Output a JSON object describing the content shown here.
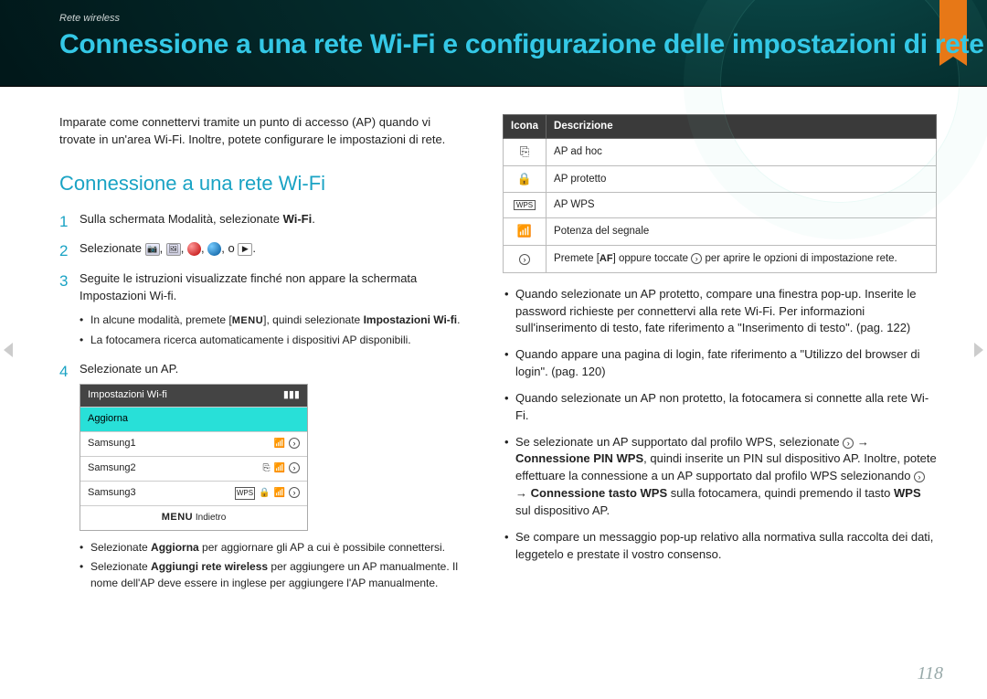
{
  "breadcrumb": "Rete wireless",
  "title": "Connessione a una rete Wi-Fi e configurazione delle impostazioni di rete",
  "intro": "Imparate come connettervi tramite un punto di accesso (AP) quando vi trovate in un'area Wi-Fi. Inoltre, potete configurare le impostazioni di rete.",
  "section_heading": "Connessione a una rete Wi-Fi",
  "steps": {
    "s1": {
      "num": "1",
      "text_a": "Sulla schermata Modalità, selezionate ",
      "bold": "Wi-Fi",
      "text_b": "."
    },
    "s2": {
      "num": "2",
      "text_a": "Selezionate ",
      "tail": ", o "
    },
    "s3": {
      "num": "3",
      "text": "Seguite le istruzioni visualizzate finché non appare la schermata Impostazioni Wi-fi.",
      "sub_a_pre": "In alcune modalità, premete [",
      "sub_a_key": "MENU",
      "sub_a_mid": "], quindi selezionate ",
      "sub_a_bold": "Impostazioni Wi-fi",
      "sub_a_post": ".",
      "sub_b": "La fotocamera ricerca automaticamente i dispositivi AP disponibili."
    },
    "s4": {
      "num": "4",
      "text": "Selezionate un AP."
    }
  },
  "screen": {
    "title": "Impostazioni Wi-fi",
    "refresh": "Aggiorna",
    "rows": [
      "Samsung1",
      "Samsung2",
      "Samsung3"
    ],
    "back_key": "MENU",
    "back": "Indietro"
  },
  "after_screen": {
    "a_pre": "Selezionate ",
    "a_bold": "Aggiorna",
    "a_post": " per aggiornare gli AP a cui è possibile connettersi.",
    "b_pre": "Selezionate ",
    "b_bold": "Aggiungi rete wireless",
    "b_post": " per aggiungere un AP manualmente. Il nome dell'AP deve essere in inglese per aggiungere l'AP manualmente."
  },
  "table": {
    "head_icon": "Icona",
    "head_desc": "Descrizione",
    "rows": [
      {
        "icon": "⎘",
        "desc": "AP ad hoc"
      },
      {
        "icon": "🔒",
        "desc": "AP protetto"
      },
      {
        "icon": "WPS",
        "desc": "AP WPS"
      },
      {
        "icon": "📶",
        "desc": "Potenza del segnale"
      }
    ],
    "last_pre": "Premete [",
    "last_key": "AF",
    "last_mid": "] oppure toccate ",
    "last_post": " per aprire le opzioni di impostazione rete."
  },
  "right_bullets": {
    "b1": "Quando selezionate un AP protetto, compare una finestra pop-up. Inserite le password richieste per connettervi alla rete Wi-Fi. Per informazioni sull'inserimento di testo, fate riferimento a \"Inserimento di testo\". (pag. 122)",
    "b2": "Quando appare una pagina di login, fate riferimento a \"Utilizzo del browser di login\". (pag. 120)",
    "b3": "Quando selezionate un AP non protetto, la fotocamera si connette alla rete Wi-Fi.",
    "b4_pre": "Se selezionate un AP supportato dal profilo WPS, selezionate ",
    "b4_arrow": " → ",
    "b4_bold1": "Connessione PIN WPS",
    "b4_mid1": ", quindi inserite un PIN sul dispositivo AP. Inoltre, potete effettuare la connessione a un AP supportato dal profilo WPS selezionando ",
    "b4_bold2": "Connessione tasto WPS",
    "b4_mid2": " sulla fotocamera, quindi premendo il tasto ",
    "b4_bold3": "WPS",
    "b4_post": " sul dispositivo AP.",
    "b5": "Se compare un messaggio pop-up relativo alla normativa sulla raccolta dei dati, leggetelo e prestate il vostro consenso."
  },
  "page_number": "118"
}
